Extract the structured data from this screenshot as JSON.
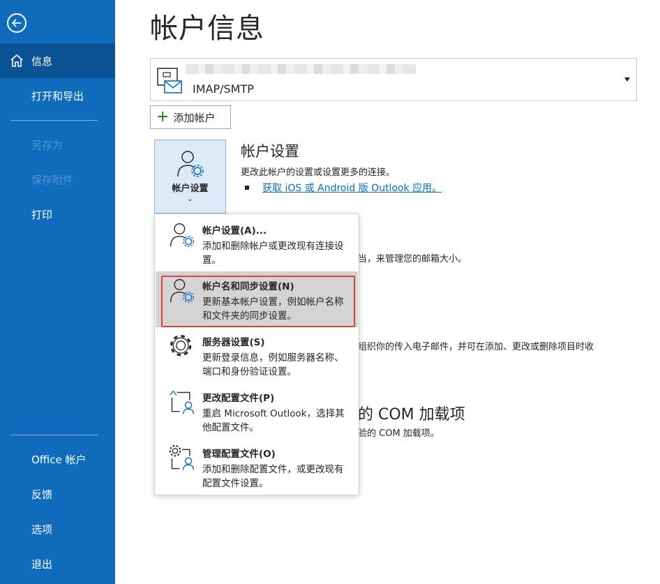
{
  "sidebar": {
    "items": [
      {
        "label": "信息"
      },
      {
        "label": "打开和导出"
      },
      {
        "label": "另存为"
      },
      {
        "label": "保存附件"
      },
      {
        "label": "打印"
      },
      {
        "label": "Office 帐户"
      },
      {
        "label": "反馈"
      },
      {
        "label": "选项"
      },
      {
        "label": "退出"
      }
    ]
  },
  "main": {
    "title": "帐户信息",
    "account": {
      "type": "IMAP/SMTP"
    },
    "add_account_label": "添加帐户",
    "account_settings_button": "帐户设置",
    "section": {
      "title": "帐户设置",
      "desc": "更改此帐户的设置或设置更多的连接。",
      "link": "获取 iOS 或 Android 版 Outlook 应用。"
    },
    "background": {
      "mailbox_fragment": "当，来管理您的邮箱大小。",
      "rules_fragment": "组织你的传入电子邮件，并可在添加、更改或删除项目时收",
      "com_heading_fragment": "的 COM 加载项",
      "com_desc_fragment": "验的 COM 加载项。"
    }
  },
  "menu": {
    "items": [
      {
        "title": "帐户设置(A)...",
        "desc": "添加和删除帐户或更改现有连接设置。",
        "icon": "user-gear-icon"
      },
      {
        "title": "帐户名和同步设置(N)",
        "desc": "更新基本帐户设置，例如帐户名称和文件夹的同步设置。",
        "icon": "user-gear-icon"
      },
      {
        "title": "服务器设置(S)",
        "desc": "更新登录信息，例如服务器名称、端口和身份验证设置。",
        "icon": "gear-icon"
      },
      {
        "title": "更改配置文件(P)",
        "desc": "重启 Microsoft Outlook，选择其他配置文件。",
        "icon": "profile-switch-icon"
      },
      {
        "title": "管理配置文件(O)",
        "desc": "添加和删除配置文件，或更改现有配置文件设置。",
        "icon": "profile-gear-icon"
      }
    ]
  },
  "colors": {
    "sidebar": "#0f6cbd",
    "sidebar_active": "#0b5294",
    "highlight": "#d4d4d4",
    "callout": "#d9413e",
    "link": "#0f6cbd"
  }
}
